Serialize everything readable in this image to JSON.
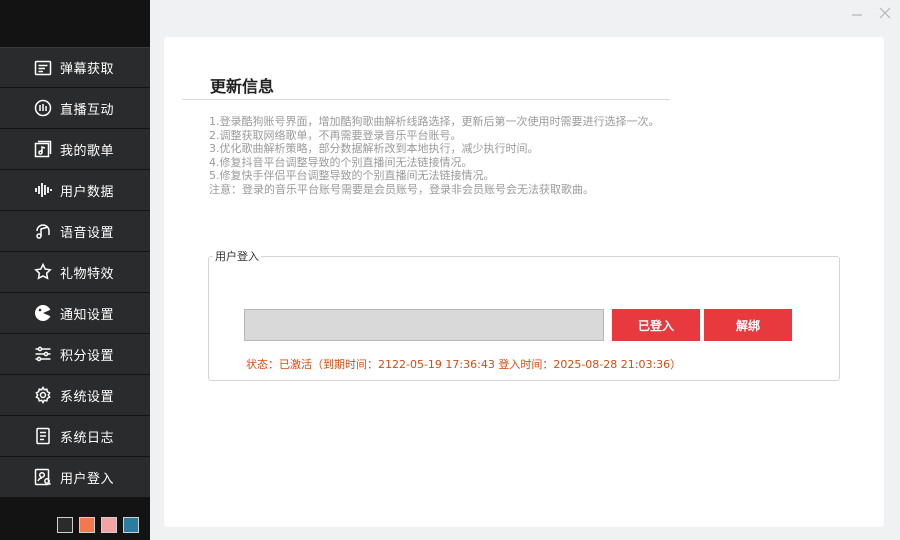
{
  "sidebar": {
    "items": [
      {
        "label": "弹幕获取",
        "icon": "danmaku-icon"
      },
      {
        "label": "直播互动",
        "icon": "live-interact-icon"
      },
      {
        "label": "我的歌单",
        "icon": "playlist-icon"
      },
      {
        "label": "用户数据",
        "icon": "user-data-icon"
      },
      {
        "label": "语音设置",
        "icon": "voice-icon"
      },
      {
        "label": "礼物特效",
        "icon": "gift-effect-icon"
      },
      {
        "label": "通知设置",
        "icon": "notify-icon"
      },
      {
        "label": "积分设置",
        "icon": "points-icon"
      },
      {
        "label": "系统设置",
        "icon": "gear-icon"
      },
      {
        "label": "系统日志",
        "icon": "log-icon"
      },
      {
        "label": "用户登入",
        "icon": "user-login-icon"
      }
    ],
    "theme_colors": [
      "#2a2b2c",
      "#f2794f",
      "#f4a3a5",
      "#2b7ca0"
    ]
  },
  "window": {
    "minimize_icon": "minimize-icon",
    "close_icon": "close-icon"
  },
  "update": {
    "title": "更新信息",
    "notes": [
      "1.登录酷狗账号界面，增加酷狗歌曲解析线路选择，更新后第一次使用时需要进行选择一次。",
      "2.调整获取网络歌单，不再需要登录音乐平台账号。",
      "3.优化歌曲解析策略，部分数据解析改到本地执行，减少执行时间。",
      "4.修复抖音平台调整导致的个别直播间无法链接情况。",
      "5.修复快手伴侣平台调整导致的个别直播间无法链接情况。",
      "注意：登录的音乐平台账号需要是会员账号，登录非会员账号会无法获取歌曲。"
    ]
  },
  "login": {
    "legend": "用户登入",
    "input_value": "",
    "login_button": "已登入",
    "unbind_button": "解绑",
    "status": "状态：已激活（到期时间：2122-05-19 17:36:43 登入时间：2025-08-28 21:03:36）",
    "accent_color": "#e8393f",
    "status_color": "#d84a0f"
  }
}
